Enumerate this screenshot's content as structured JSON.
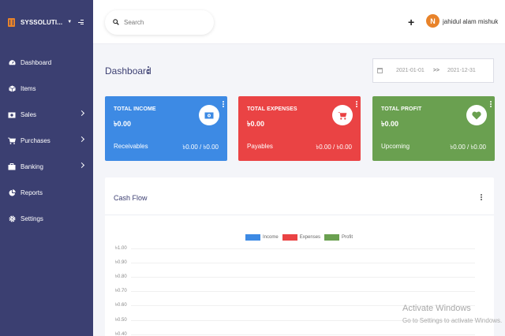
{
  "brand": {
    "name": "SYSSOLUTI..."
  },
  "sidebar": {
    "items": [
      {
        "label": "Dashboard",
        "icon": "dashboard-icon"
      },
      {
        "label": "Items",
        "icon": "cube-icon"
      },
      {
        "label": "Sales",
        "icon": "money-icon"
      },
      {
        "label": "Purchases",
        "icon": "cart-icon"
      },
      {
        "label": "Banking",
        "icon": "briefcase-icon"
      },
      {
        "label": "Reports",
        "icon": "pie-chart-icon"
      },
      {
        "label": "Settings",
        "icon": "gear-icon"
      }
    ]
  },
  "header": {
    "search_placeholder": "Search",
    "add_label": "+",
    "avatar_initials": "N",
    "user_name": "jahidul alam mishuk"
  },
  "page": {
    "title": "Dashboard"
  },
  "date_range": {
    "from": "2021-01-01",
    "separator": ">>",
    "to": "2021-12-31"
  },
  "cards": {
    "income": {
      "title": "TOTAL INCOME",
      "amount": "৳0.00",
      "footer_label": "Receivables",
      "footer_value": "৳0.00 / ৳0.00",
      "color": "#3d8ae4"
    },
    "expenses": {
      "title": "TOTAL EXPENSES",
      "amount": "৳0.00",
      "footer_label": "Payables",
      "footer_value": "৳0.00 / ৳0.00",
      "color": "#ea4344"
    },
    "profit": {
      "title": "TOTAL PROFIT",
      "amount": "৳0.00",
      "footer_label": "Upcoming",
      "footer_value": "৳0.00 / ৳0.00",
      "color": "#6aa050"
    }
  },
  "cashflow": {
    "title": "Cash Flow",
    "legend": [
      {
        "label": "Income",
        "color": "#3d8ae4"
      },
      {
        "label": "Expenses",
        "color": "#ea4344"
      },
      {
        "label": "Profit",
        "color": "#6aa050"
      }
    ],
    "y_ticks": [
      "৳1.00",
      "৳0.90",
      "৳0.80",
      "৳0.70",
      "৳0.60",
      "৳0.50",
      "৳0.40"
    ]
  },
  "watermark": {
    "title": "Activate Windows",
    "subtitle": "Go to Settings to activate Windows."
  }
}
